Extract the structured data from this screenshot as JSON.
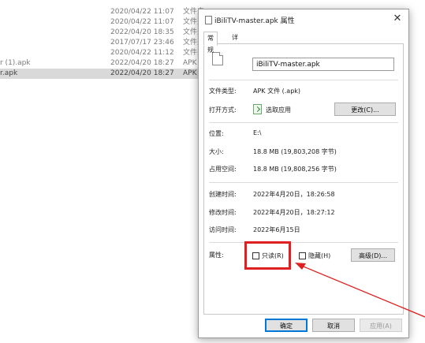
{
  "background_list": [
    {
      "name": "",
      "date": "2020/04/22 11:07",
      "type": "文件夹"
    },
    {
      "name": "",
      "date": "2020/04/22 11:07",
      "type": "文件夹"
    },
    {
      "name": "",
      "date": "2022/04/20 18:35",
      "type": "文件夹"
    },
    {
      "name": "",
      "date": "2017/07/17 23:46",
      "type": "文件夹"
    },
    {
      "name": "",
      "date": "2020/04/22 11:12",
      "type": "文件夹"
    },
    {
      "name": "r (1).apk",
      "date": "2022/04/20 18:27",
      "type": "APK"
    },
    {
      "name": "r.apk",
      "date": "2022/04/20 18:27",
      "type": "APK"
    }
  ],
  "dialog": {
    "title": "iBiliTV-master.apk 属性",
    "close_glyph": "✕",
    "tabs": [
      "常规",
      "详细信息"
    ],
    "file_name": "iBiliTV-master.apk",
    "file_type_label": "文件类型:",
    "file_type_value": "APK 文件 (.apk)",
    "open_with_label": "打开方式:",
    "open_with_value": "选取应用",
    "change_button": "更改(C)...",
    "location_label": "位置:",
    "location_value": "E:\\",
    "size_label": "大小:",
    "size_value": "18.8 MB (19,803,208 字节)",
    "disk_size_label": "占用空间:",
    "disk_size_value": "18.8 MB (19,808,256 字节)",
    "created_label": "创建时间:",
    "created_value": "2022年4月20日，18:26:58",
    "modified_label": "修改时间:",
    "modified_value": "2022年4月20日，18:27:12",
    "accessed_label": "访问时间:",
    "accessed_value": "2022年6月15日",
    "attributes_label": "属性:",
    "readonly_label": "只读(R)",
    "hidden_label": "隐藏(H)",
    "advanced_button": "高级(D)...",
    "ok_button": "确定",
    "cancel_button": "取消",
    "apply_button": "应用(A)"
  },
  "annotation": {
    "highlight_color": "#e02020"
  }
}
